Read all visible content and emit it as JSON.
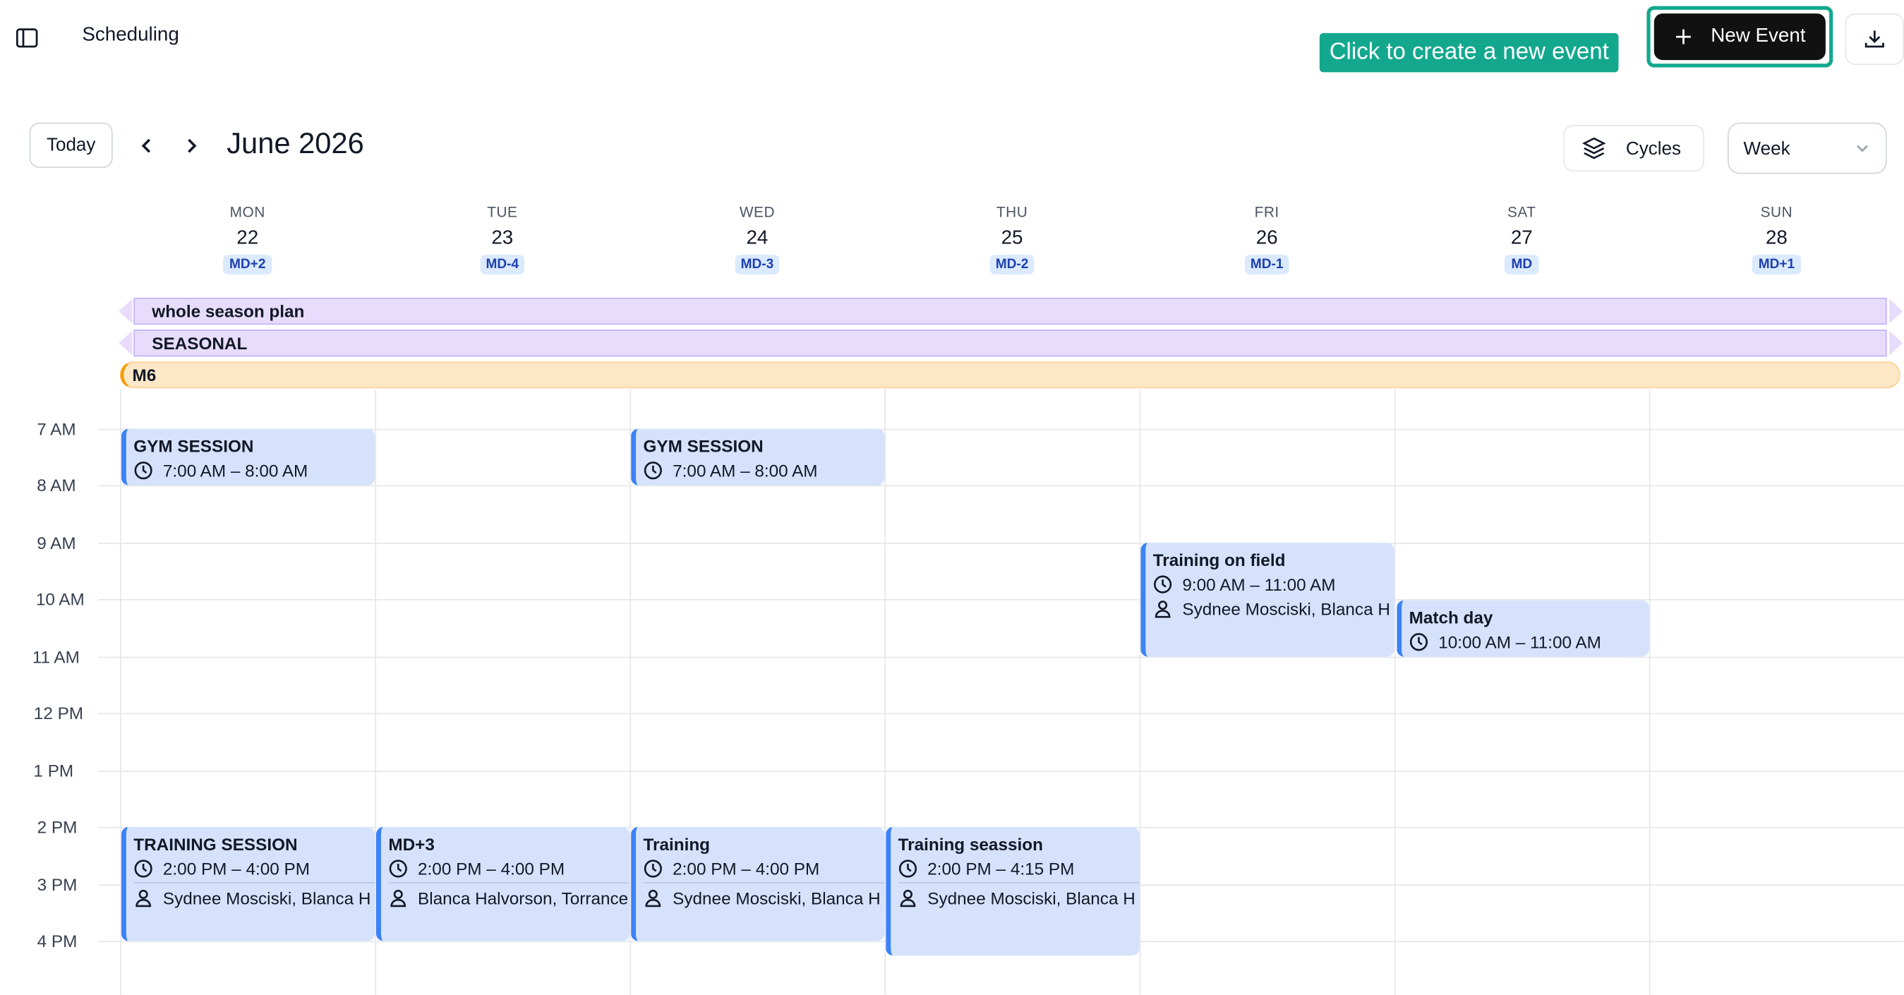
{
  "header": {
    "title": "Scheduling",
    "tooltip": "Click to create a new event",
    "new_event_label": "New Event"
  },
  "toolbar": {
    "today_label": "Today",
    "month_title": "June 2026",
    "cycles_label": "Cycles",
    "view_value": "Week"
  },
  "days": [
    {
      "name": "MON",
      "num": "22",
      "badge": "MD+2"
    },
    {
      "name": "TUE",
      "num": "23",
      "badge": "MD-4"
    },
    {
      "name": "WED",
      "num": "24",
      "badge": "MD-3"
    },
    {
      "name": "THU",
      "num": "25",
      "badge": "MD-2"
    },
    {
      "name": "FRI",
      "num": "26",
      "badge": "MD-1"
    },
    {
      "name": "SAT",
      "num": "27",
      "badge": "MD"
    },
    {
      "name": "SUN",
      "num": "28",
      "badge": "MD+1"
    }
  ],
  "allday": [
    {
      "label": "whole season plan"
    },
    {
      "label": "SEASONAL"
    },
    {
      "label": "M6"
    }
  ],
  "hours": [
    "7 AM",
    "8 AM",
    "9 AM",
    "10 AM",
    "11 AM",
    "12 PM",
    "1 PM",
    "2 PM",
    "3 PM",
    "4 PM"
  ],
  "events": [
    {
      "title": "GYM SESSION",
      "time": "7:00 AM – 8:00 AM",
      "people": ""
    },
    {
      "title": "GYM SESSION",
      "time": "7:00 AM – 8:00 AM",
      "people": ""
    },
    {
      "title": "Training on field",
      "time": "9:00 AM – 11:00 AM",
      "people": "Sydnee Mosciski, Blanca H"
    },
    {
      "title": "Match day",
      "time": "10:00 AM – 11:00 AM",
      "people": ""
    },
    {
      "title": "TRAINING SESSION",
      "time": "2:00 PM – 4:00 PM",
      "people": "Sydnee Mosciski, Blanca H"
    },
    {
      "title": "MD+3",
      "time": "2:00 PM – 4:00 PM",
      "people": "Blanca Halvorson, Torrance"
    },
    {
      "title": "Training",
      "time": "2:00 PM – 4:00 PM",
      "people": "Sydnee Mosciski, Blanca H"
    },
    {
      "title": "Training seassion",
      "time": "2:00 PM – 4:15 PM",
      "people": "Sydnee Mosciski, Blanca H"
    }
  ]
}
